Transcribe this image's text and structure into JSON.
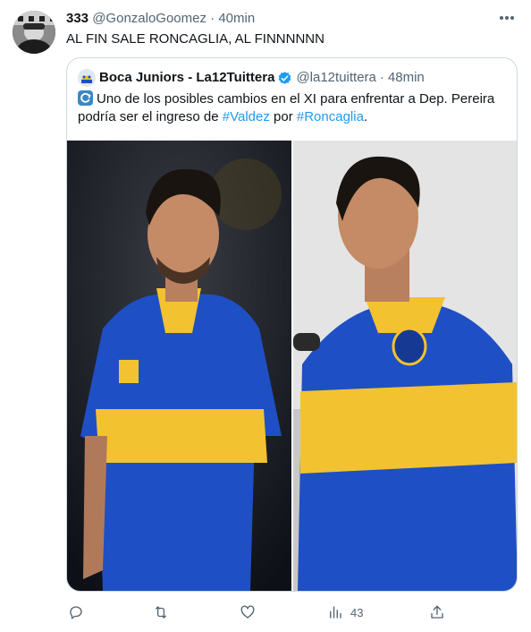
{
  "tweet": {
    "author_name": "333",
    "author_handle": "@GonzaloGoomez",
    "separator": "·",
    "time": "40min",
    "text": "AL FIN SALE RONCAGLIA, AL FINNNNNN"
  },
  "quoted": {
    "author_name": "Boca Juniors - La12Tuittera",
    "author_handle": "@la12tuittera",
    "separator": "·",
    "time": "48min",
    "text_part1": "Uno de los posibles cambios en el XI para enfrentar a Dep. Pereira podría ser el ingreso de ",
    "hashtag1": "#Valdez",
    "text_part2": " por ",
    "hashtag2": "#Roncaglia",
    "text_part3": "."
  },
  "actions": {
    "views_count": "43"
  },
  "colors": {
    "link": "#1d9bf0",
    "muted": "#536471",
    "boca_blue": "#1f4fc4",
    "boca_gold": "#f2c230"
  },
  "icons": [
    "more-icon",
    "verified-icon",
    "reply-icon",
    "retweet-icon",
    "like-icon",
    "views-icon",
    "share-icon"
  ]
}
